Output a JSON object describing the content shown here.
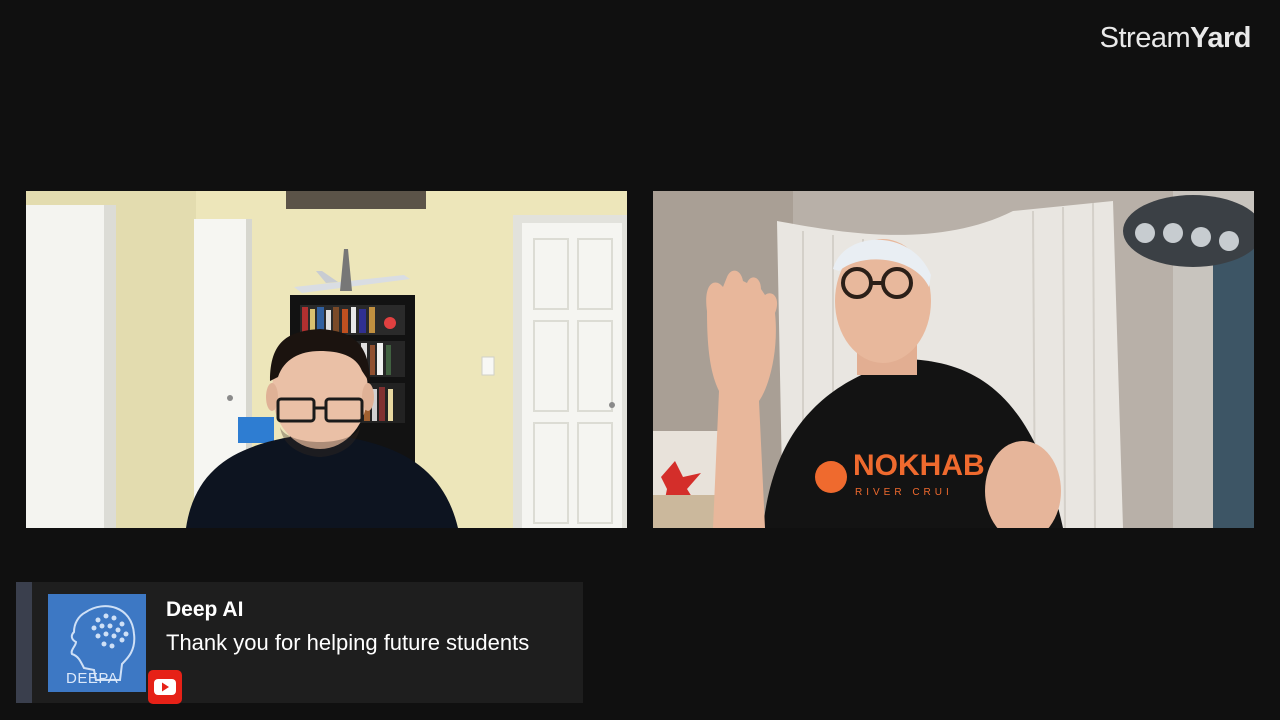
{
  "brand": {
    "light": "Stream",
    "bold": "Yard"
  },
  "participants": [
    {
      "id": "guest-left",
      "shirt_color": "#0d1420",
      "wall_color": "#ece5b8"
    },
    {
      "id": "guest-right",
      "shirt_color": "#131313",
      "shirt_text": "NOKHAB",
      "shirt_subtext": "RIVER CRUI",
      "accent_color": "#ef6a2e"
    }
  ],
  "comment": {
    "author": "Deep AI",
    "message": "Thank you for helping future students",
    "avatar_text": "DEEPA",
    "platform_icon": "youtube-icon"
  },
  "colors": {
    "background": "#101010",
    "comment_bg": "#1e1e1e",
    "accent_bar": "#3a3f4d",
    "avatar_bg": "#3d78c4",
    "youtube_red": "#e62117"
  }
}
